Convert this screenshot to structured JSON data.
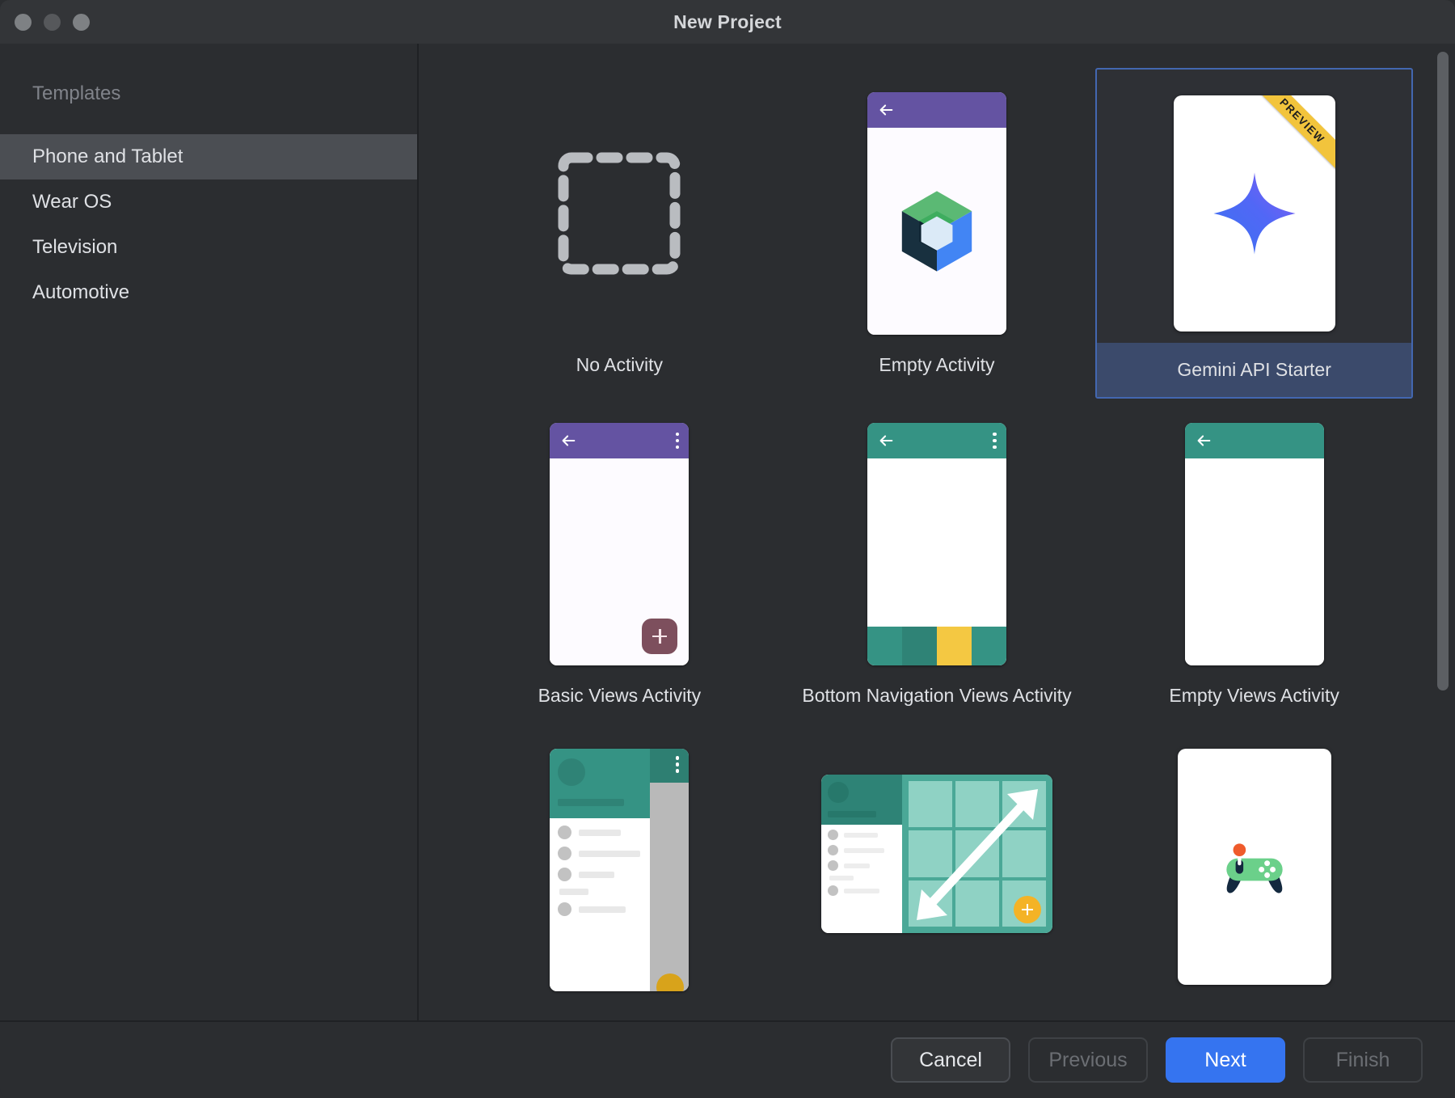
{
  "window": {
    "title": "New Project",
    "traffic_lights": [
      "close",
      "minimize",
      "maximize"
    ]
  },
  "sidebar": {
    "heading": "Templates",
    "items": [
      {
        "label": "Phone and Tablet",
        "selected": true
      },
      {
        "label": "Wear OS",
        "selected": false
      },
      {
        "label": "Television",
        "selected": false
      },
      {
        "label": "Automotive",
        "selected": false
      }
    ]
  },
  "templates": [
    {
      "label": "No Activity",
      "icon": "dashed-square-icon",
      "selected": false,
      "badge": ""
    },
    {
      "label": "Empty Activity",
      "icon": "jetpack-compose-cube-icon",
      "selected": false,
      "badge": ""
    },
    {
      "label": "Gemini API Starter",
      "icon": "gemini-sparkle-icon",
      "selected": true,
      "badge": "PREVIEW"
    },
    {
      "label": "Basic Views Activity",
      "icon": "basic-views-phone-icon",
      "selected": false,
      "badge": ""
    },
    {
      "label": "Bottom Navigation Views Activity",
      "icon": "bottom-nav-phone-icon",
      "selected": false,
      "badge": ""
    },
    {
      "label": "Empty Views Activity",
      "icon": "empty-views-phone-icon",
      "selected": false,
      "badge": ""
    },
    {
      "label": "",
      "icon": "navigation-drawer-icon",
      "selected": false,
      "badge": ""
    },
    {
      "label": "",
      "icon": "responsive-grid-icon",
      "selected": false,
      "badge": ""
    },
    {
      "label": "",
      "icon": "game-controller-icon",
      "selected": false,
      "badge": ""
    }
  ],
  "footer": {
    "cancel": "Cancel",
    "previous": "Previous",
    "next": "Next",
    "finish": "Finish"
  },
  "colors": {
    "dialog_background": "#2b2d30",
    "titlebar_background": "#333538",
    "sidebar_selected": "#4b4e53",
    "selection_border": "#4367b0",
    "selection_label_background": "#3b4a6b",
    "primary_button": "#3574f0",
    "material_purple": "#6453a2",
    "material_teal": "#359384",
    "accent_yellow": "#f4c842",
    "ribbon_yellow": "#f2c43c"
  }
}
